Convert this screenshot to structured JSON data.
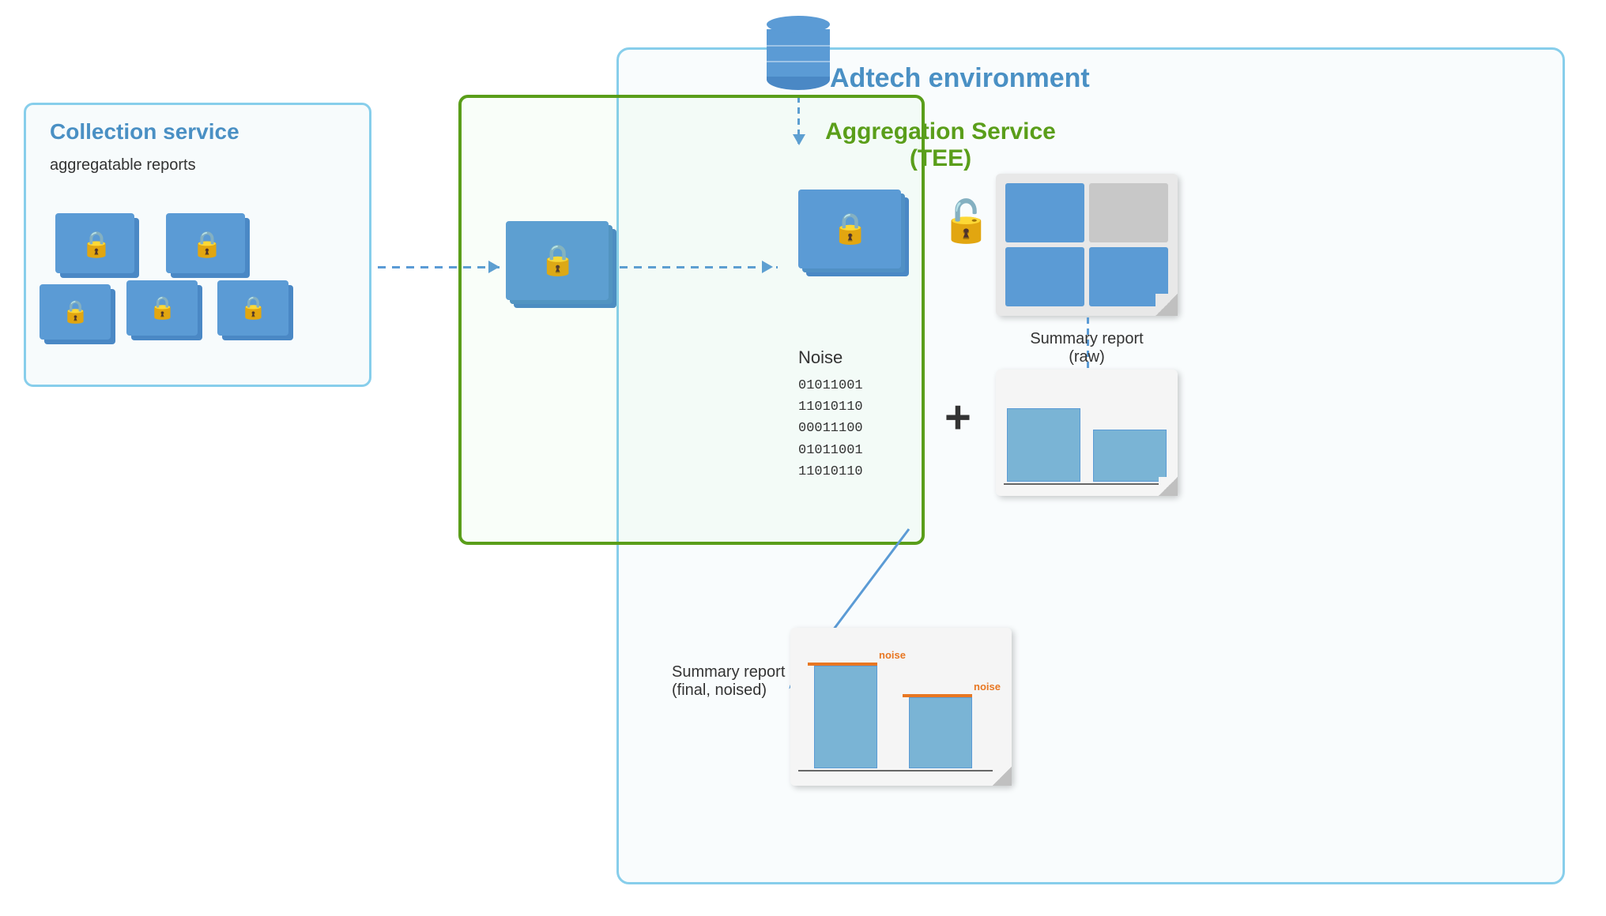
{
  "adtech": {
    "title": "Adtech environment"
  },
  "collection": {
    "title": "Collection service",
    "subtitle": "aggregatable reports"
  },
  "aggregation": {
    "title": "Aggregation Service",
    "subtitle": "(TEE)"
  },
  "noise": {
    "label": "Noise",
    "binary": [
      "01011001",
      "11010110",
      "00011100",
      "01011001",
      "11010110"
    ]
  },
  "summary_raw": {
    "label": "Summary report",
    "sublabel": "(raw)"
  },
  "summary_final": {
    "label": "Summary report",
    "sublabel": "(final, noised)"
  },
  "noise_tag1": "noise",
  "noise_tag2": "noise",
  "plus": "+"
}
